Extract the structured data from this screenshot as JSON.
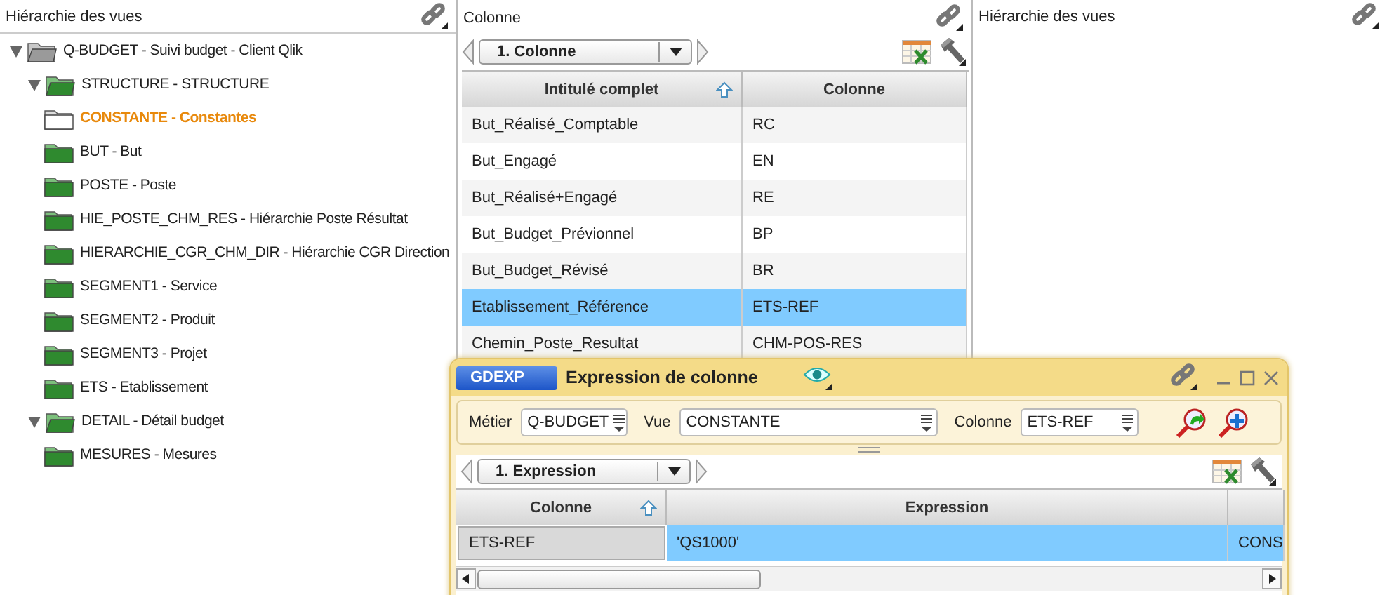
{
  "tree_pane": {
    "title": "Hiérarchie des vues",
    "nodes": [
      {
        "label": "Q-BUDGET - Suivi budget - Client Qlik",
        "selected": false,
        "expanded": true,
        "children": [
          {
            "label": "STRUCTURE - STRUCTURE",
            "selected": false,
            "expanded": true,
            "children": [
              {
                "label": "CONSTANTE - Constantes",
                "selected": true
              },
              {
                "label": "BUT - But",
                "selected": false
              },
              {
                "label": "POSTE - Poste",
                "selected": false
              },
              {
                "label": "HIE_POSTE_CHM_RES - Hiérarchie Poste Résultat",
                "selected": false
              },
              {
                "label": "HIERARCHIE_CGR_CHM_DIR - Hiérarchie CGR Direction",
                "selected": false
              },
              {
                "label": "SEGMENT1 - Service",
                "selected": false
              },
              {
                "label": "SEGMENT2 - Produit",
                "selected": false
              },
              {
                "label": "SEGMENT3 - Projet",
                "selected": false
              },
              {
                "label": "ETS - Etablissement",
                "selected": false
              }
            ]
          },
          {
            "label": "DETAIL - Détail budget",
            "selected": false,
            "expanded": true,
            "children": [
              {
                "label": "MESURES - Mesures",
                "selected": false
              }
            ]
          }
        ]
      }
    ]
  },
  "column_pane": {
    "title": "Colonne",
    "view_select": "1. Colonne",
    "table": {
      "columns": [
        {
          "label": "Intitulé complet",
          "sorted": true
        },
        {
          "label": "Colonne",
          "sorted": false
        }
      ],
      "rows": [
        {
          "cells": [
            "But_Réalisé_Comptable",
            "RC"
          ],
          "selected": false
        },
        {
          "cells": [
            "But_Engagé",
            "EN"
          ],
          "selected": false
        },
        {
          "cells": [
            "But_Réalisé+Engagé",
            "RE"
          ],
          "selected": false
        },
        {
          "cells": [
            "But_Budget_Prévionnel",
            "BP"
          ],
          "selected": false
        },
        {
          "cells": [
            "But_Budget_Révisé",
            "BR"
          ],
          "selected": false
        },
        {
          "cells": [
            "Etablissement_Référence",
            "ETS-REF"
          ],
          "selected": true
        },
        {
          "cells": [
            "Chemin_Poste_Resultat",
            "CHM-POS-RES"
          ],
          "selected": false
        }
      ]
    }
  },
  "right_pane": {
    "title": "Hiérarchie des vues"
  },
  "dialog": {
    "badge": "GDEXP",
    "title": "Expression de colonne",
    "filters": [
      {
        "label": "Métier",
        "value": "Q-BUDGET"
      },
      {
        "label": "Vue",
        "value": "CONSTANTE"
      },
      {
        "label": "Colonne",
        "value": "ETS-REF"
      }
    ],
    "view_select": "1. Expression",
    "table": {
      "columns": [
        {
          "label": "Colonne",
          "sorted": true
        },
        {
          "label": "Expression",
          "sorted": false
        }
      ],
      "rows": [
        {
          "cells": [
            "ETS-REF",
            "'QS1000'",
            "CONS"
          ],
          "selected": true
        }
      ]
    }
  }
}
